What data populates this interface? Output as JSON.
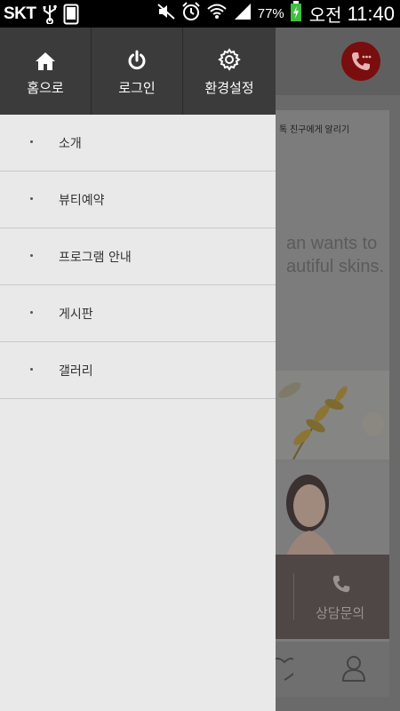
{
  "status_bar": {
    "carrier": "SKT",
    "battery_percent": "77%",
    "ampm": "오전",
    "time": "11:40",
    "icons": [
      "usb-icon",
      "screenshot-icon",
      "mute-icon",
      "alarm-icon",
      "wifi-icon",
      "signal-icon",
      "battery-charging-icon"
    ]
  },
  "drawer": {
    "header": [
      {
        "label": "홈으로",
        "icon": "home-icon"
      },
      {
        "label": "로그인",
        "icon": "power-icon"
      },
      {
        "label": "환경설정",
        "icon": "gear-icon"
      }
    ],
    "menu": [
      {
        "label": "소개"
      },
      {
        "label": "뷰티예약"
      },
      {
        "label": "프로그램 안내"
      },
      {
        "label": "게시판"
      },
      {
        "label": "갤러리"
      }
    ]
  },
  "background_app": {
    "notify_text": "톡 친구에게 알리기",
    "tagline_1": "an wants to",
    "tagline_2": "autiful skins.",
    "consult_label": "상담문의",
    "colors": {
      "call_button": "#7a0d0d",
      "drawer_header": "#3b3b3b",
      "drawer_bg": "#e9e9e9"
    }
  }
}
